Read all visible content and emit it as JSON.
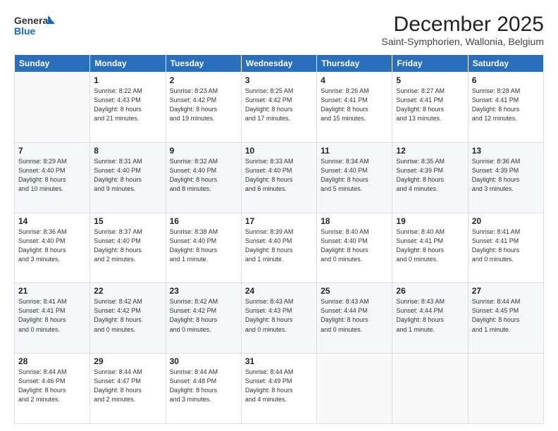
{
  "logo": {
    "line1": "General",
    "line2": "Blue"
  },
  "title": "December 2025",
  "subtitle": "Saint-Symphorien, Wallonia, Belgium",
  "header_days": [
    "Sunday",
    "Monday",
    "Tuesday",
    "Wednesday",
    "Thursday",
    "Friday",
    "Saturday"
  ],
  "weeks": [
    [
      {
        "day": "",
        "info": ""
      },
      {
        "day": "1",
        "info": "Sunrise: 8:22 AM\nSunset: 4:43 PM\nDaylight: 8 hours\nand 21 minutes."
      },
      {
        "day": "2",
        "info": "Sunrise: 8:23 AM\nSunset: 4:42 PM\nDaylight: 8 hours\nand 19 minutes."
      },
      {
        "day": "3",
        "info": "Sunrise: 8:25 AM\nSunset: 4:42 PM\nDaylight: 8 hours\nand 17 minutes."
      },
      {
        "day": "4",
        "info": "Sunrise: 8:26 AM\nSunset: 4:41 PM\nDaylight: 8 hours\nand 15 minutes."
      },
      {
        "day": "5",
        "info": "Sunrise: 8:27 AM\nSunset: 4:41 PM\nDaylight: 8 hours\nand 13 minutes."
      },
      {
        "day": "6",
        "info": "Sunrise: 8:28 AM\nSunset: 4:41 PM\nDaylight: 8 hours\nand 12 minutes."
      }
    ],
    [
      {
        "day": "7",
        "info": "Sunrise: 8:29 AM\nSunset: 4:40 PM\nDaylight: 8 hours\nand 10 minutes."
      },
      {
        "day": "8",
        "info": "Sunrise: 8:31 AM\nSunset: 4:40 PM\nDaylight: 8 hours\nand 9 minutes."
      },
      {
        "day": "9",
        "info": "Sunrise: 8:32 AM\nSunset: 4:40 PM\nDaylight: 8 hours\nand 8 minutes."
      },
      {
        "day": "10",
        "info": "Sunrise: 8:33 AM\nSunset: 4:40 PM\nDaylight: 8 hours\nand 6 minutes."
      },
      {
        "day": "11",
        "info": "Sunrise: 8:34 AM\nSunset: 4:40 PM\nDaylight: 8 hours\nand 5 minutes."
      },
      {
        "day": "12",
        "info": "Sunrise: 8:35 AM\nSunset: 4:39 PM\nDaylight: 8 hours\nand 4 minutes."
      },
      {
        "day": "13",
        "info": "Sunrise: 8:36 AM\nSunset: 4:39 PM\nDaylight: 8 hours\nand 3 minutes."
      }
    ],
    [
      {
        "day": "14",
        "info": "Sunrise: 8:36 AM\nSunset: 4:40 PM\nDaylight: 8 hours\nand 3 minutes."
      },
      {
        "day": "15",
        "info": "Sunrise: 8:37 AM\nSunset: 4:40 PM\nDaylight: 8 hours\nand 2 minutes."
      },
      {
        "day": "16",
        "info": "Sunrise: 8:38 AM\nSunset: 4:40 PM\nDaylight: 8 hours\nand 1 minute."
      },
      {
        "day": "17",
        "info": "Sunrise: 8:39 AM\nSunset: 4:40 PM\nDaylight: 8 hours\nand 1 minute."
      },
      {
        "day": "18",
        "info": "Sunrise: 8:40 AM\nSunset: 4:40 PM\nDaylight: 8 hours\nand 0 minutes."
      },
      {
        "day": "19",
        "info": "Sunrise: 8:40 AM\nSunset: 4:41 PM\nDaylight: 8 hours\nand 0 minutes."
      },
      {
        "day": "20",
        "info": "Sunrise: 8:41 AM\nSunset: 4:41 PM\nDaylight: 8 hours\nand 0 minutes."
      }
    ],
    [
      {
        "day": "21",
        "info": "Sunrise: 8:41 AM\nSunset: 4:41 PM\nDaylight: 8 hours\nand 0 minutes."
      },
      {
        "day": "22",
        "info": "Sunrise: 8:42 AM\nSunset: 4:42 PM\nDaylight: 8 hours\nand 0 minutes."
      },
      {
        "day": "23",
        "info": "Sunrise: 8:42 AM\nSunset: 4:42 PM\nDaylight: 8 hours\nand 0 minutes."
      },
      {
        "day": "24",
        "info": "Sunrise: 8:43 AM\nSunset: 4:43 PM\nDaylight: 8 hours\nand 0 minutes."
      },
      {
        "day": "25",
        "info": "Sunrise: 8:43 AM\nSunset: 4:44 PM\nDaylight: 8 hours\nand 0 minutes."
      },
      {
        "day": "26",
        "info": "Sunrise: 8:43 AM\nSunset: 4:44 PM\nDaylight: 8 hours\nand 1 minute."
      },
      {
        "day": "27",
        "info": "Sunrise: 8:44 AM\nSunset: 4:45 PM\nDaylight: 8 hours\nand 1 minute."
      }
    ],
    [
      {
        "day": "28",
        "info": "Sunrise: 8:44 AM\nSunset: 4:46 PM\nDaylight: 8 hours\nand 2 minutes."
      },
      {
        "day": "29",
        "info": "Sunrise: 8:44 AM\nSunset: 4:47 PM\nDaylight: 8 hours\nand 2 minutes."
      },
      {
        "day": "30",
        "info": "Sunrise: 8:44 AM\nSunset: 4:48 PM\nDaylight: 8 hours\nand 3 minutes."
      },
      {
        "day": "31",
        "info": "Sunrise: 8:44 AM\nSunset: 4:49 PM\nDaylight: 8 hours\nand 4 minutes."
      },
      {
        "day": "",
        "info": ""
      },
      {
        "day": "",
        "info": ""
      },
      {
        "day": "",
        "info": ""
      }
    ]
  ]
}
